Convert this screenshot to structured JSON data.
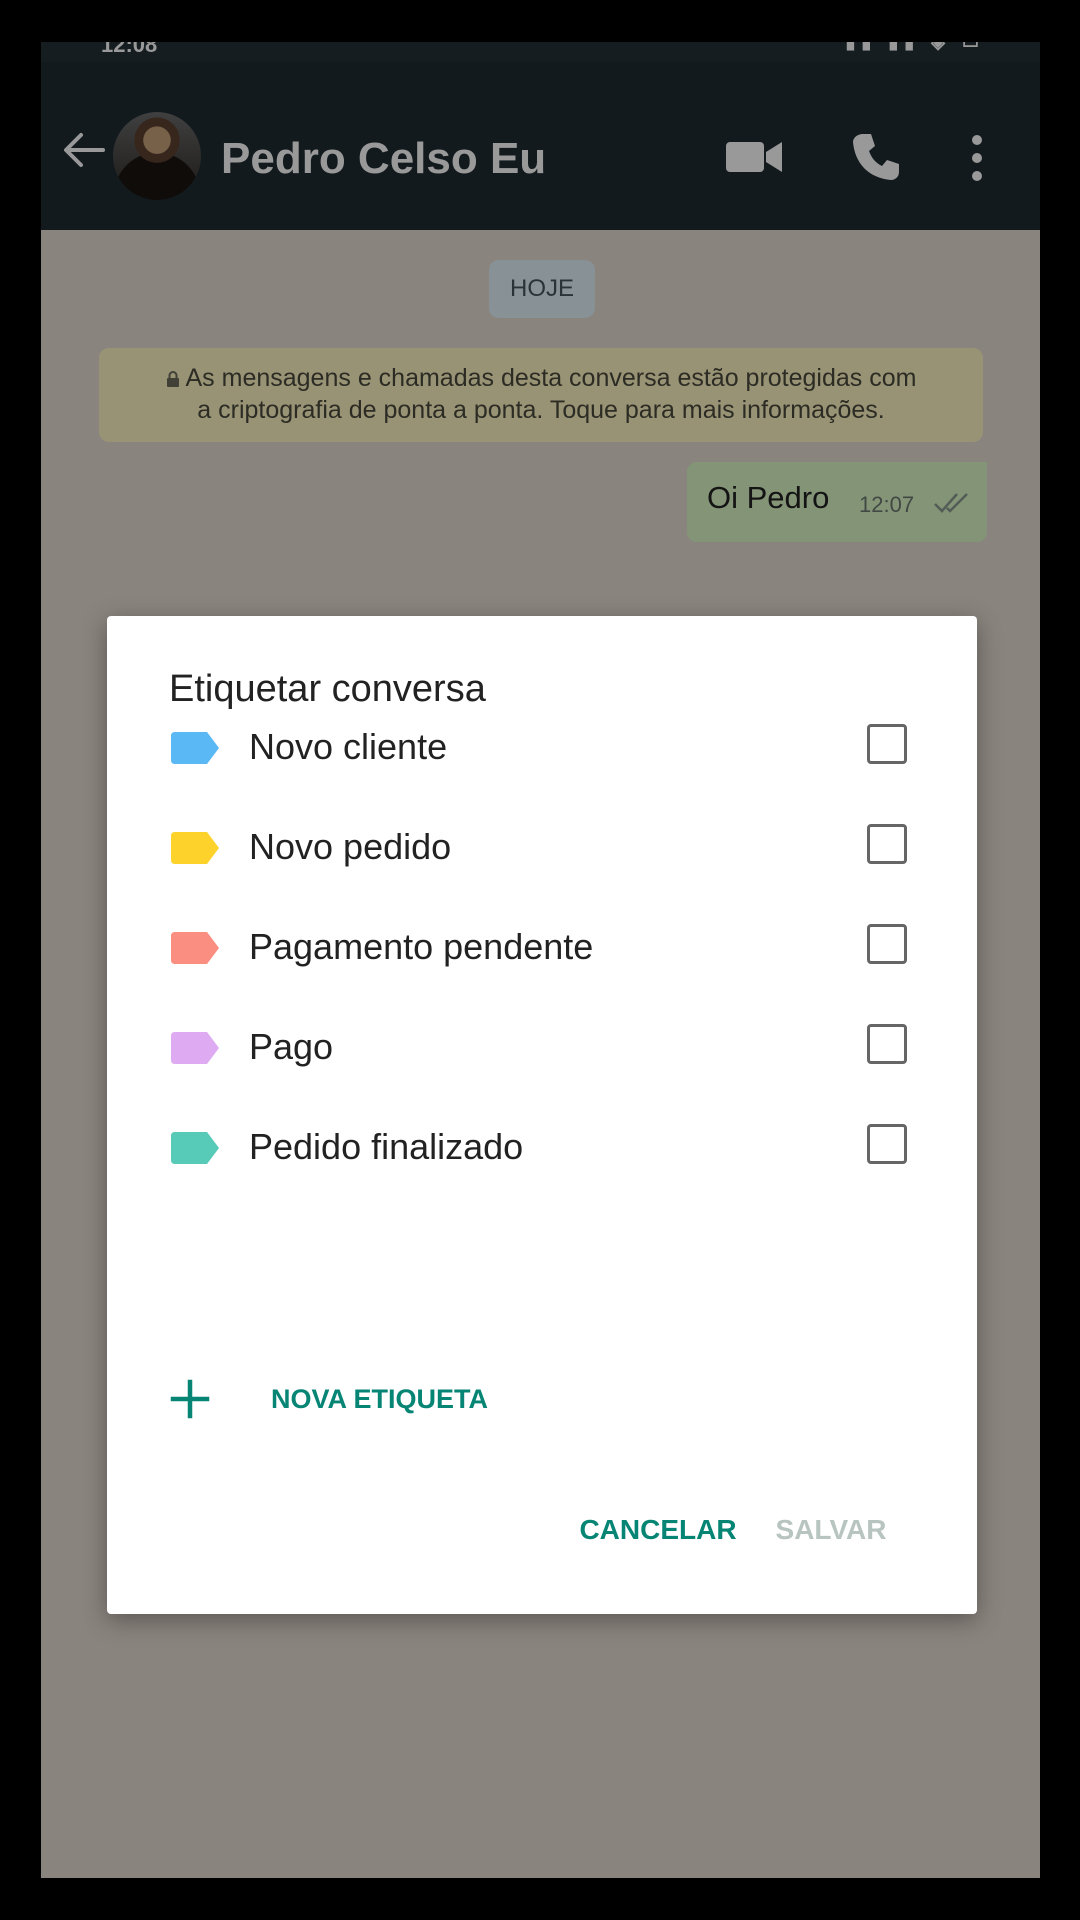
{
  "status_bar": {
    "time": "12:08"
  },
  "header": {
    "contact_name": "Pedro Celso Eu"
  },
  "chat": {
    "date_chip": "HOJE",
    "encryption_notice_line1": "As mensagens e chamadas desta conversa estão protegidas com",
    "encryption_notice_line2": "a criptografia de ponta a ponta. Toque para mais informações.",
    "message": {
      "text": "Oi Pedro",
      "time": "12:07"
    }
  },
  "dialog": {
    "title": "Etiquetar conversa",
    "labels": [
      {
        "name": "Novo cliente",
        "color": "#5ab8f5",
        "checked": false
      },
      {
        "name": "Novo pedido",
        "color": "#fdd22a",
        "checked": false
      },
      {
        "name": "Pagamento pendente",
        "color": "#fa8e80",
        "checked": false
      },
      {
        "name": "Pago",
        "color": "#deaaf2",
        "checked": false
      },
      {
        "name": "Pedido finalizado",
        "color": "#58cab8",
        "checked": false
      }
    ],
    "new_label": "NOVA ETIQUETA",
    "cancel": "CANCELAR",
    "save": "SALVAR"
  },
  "colors": {
    "accent": "#068575",
    "app_bar": "#1f2c33",
    "disabled": "#b8c4c0"
  },
  "icons": [
    "back-arrow-icon",
    "video-call-icon",
    "phone-icon",
    "more-vert-icon",
    "lock-icon",
    "double-check-icon",
    "plus-icon",
    "label-tag-icon"
  ]
}
